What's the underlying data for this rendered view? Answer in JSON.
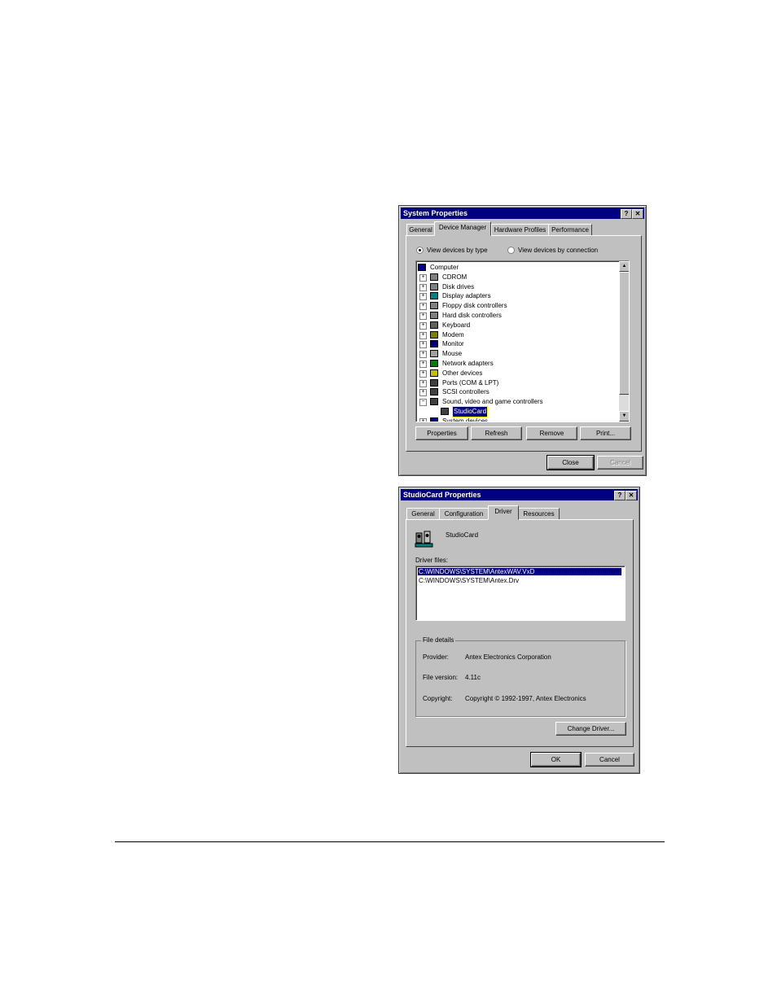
{
  "system_properties": {
    "title": "System Properties",
    "help_button": "?",
    "close_x": "✕",
    "tabs": [
      {
        "label": "General",
        "active": false
      },
      {
        "label": "Device Manager",
        "active": true
      },
      {
        "label": "Hardware Profiles",
        "active": false
      },
      {
        "label": "Performance",
        "active": false
      }
    ],
    "radio_by_type": "View devices by type",
    "radio_by_connection": "View devices by connection",
    "tree": [
      {
        "label": "Computer",
        "icon": "computer-icon",
        "expander": ""
      },
      {
        "label": "CDROM",
        "icon": "cdrom-icon",
        "expander": "+"
      },
      {
        "label": "Disk drives",
        "icon": "disk-drive-icon",
        "expander": "+"
      },
      {
        "label": "Display adapters",
        "icon": "display-adapter-icon",
        "expander": "+"
      },
      {
        "label": "Floppy disk controllers",
        "icon": "floppy-controller-icon",
        "expander": "+"
      },
      {
        "label": "Hard disk controllers",
        "icon": "hard-disk-controller-icon",
        "expander": "+"
      },
      {
        "label": "Keyboard",
        "icon": "keyboard-icon",
        "expander": "+"
      },
      {
        "label": "Modem",
        "icon": "modem-icon",
        "expander": "+"
      },
      {
        "label": "Monitor",
        "icon": "monitor-icon",
        "expander": "+"
      },
      {
        "label": "Mouse",
        "icon": "mouse-icon",
        "expander": "+"
      },
      {
        "label": "Network adapters",
        "icon": "network-adapter-icon",
        "expander": "+"
      },
      {
        "label": "Other devices",
        "icon": "question-mark-icon",
        "expander": "+"
      },
      {
        "label": "Ports (COM & LPT)",
        "icon": "port-icon",
        "expander": "+"
      },
      {
        "label": "SCSI controllers",
        "icon": "scsi-icon",
        "expander": "+"
      },
      {
        "label": "Sound, video and game controllers",
        "icon": "sound-controller-icon",
        "expander": "−"
      },
      {
        "label": "StudioCard",
        "icon": "studiocard-icon",
        "expander": "",
        "child": true,
        "selected": true
      },
      {
        "label": "System devices",
        "icon": "system-devices-icon",
        "expander": "+"
      }
    ],
    "buttons": {
      "properties": "Properties",
      "refresh": "Refresh",
      "remove": "Remove",
      "print": "Print...",
      "close": "Close",
      "cancel": "Cancel"
    }
  },
  "studiocard_properties": {
    "title": "StudioCard Properties",
    "help_button": "?",
    "close_x": "✕",
    "tabs": [
      {
        "label": "General",
        "active": false
      },
      {
        "label": "Configuration",
        "active": false
      },
      {
        "label": "Driver",
        "active": true
      },
      {
        "label": "Resources",
        "active": false
      }
    ],
    "device_name": "StudioCard",
    "driver_files_label": "Driver files:",
    "driver_files": [
      {
        "path": "C:\\WINDOWS\\SYSTEM\\AntexWAV.VxD",
        "selected": true
      },
      {
        "path": "C:\\WINDOWS\\SYSTEM\\Antex.Drv",
        "selected": false
      }
    ],
    "file_details": {
      "title": "File details",
      "provider_label": "Provider:",
      "provider": "Antex Electronics Corporation",
      "version_label": "File version:",
      "version": "4.11c",
      "copyright_label": "Copyright:",
      "copyright": "Copyright © 1992-1997, Antex Electronics"
    },
    "buttons": {
      "change_driver": "Change Driver...",
      "ok": "OK",
      "cancel": "Cancel"
    }
  }
}
